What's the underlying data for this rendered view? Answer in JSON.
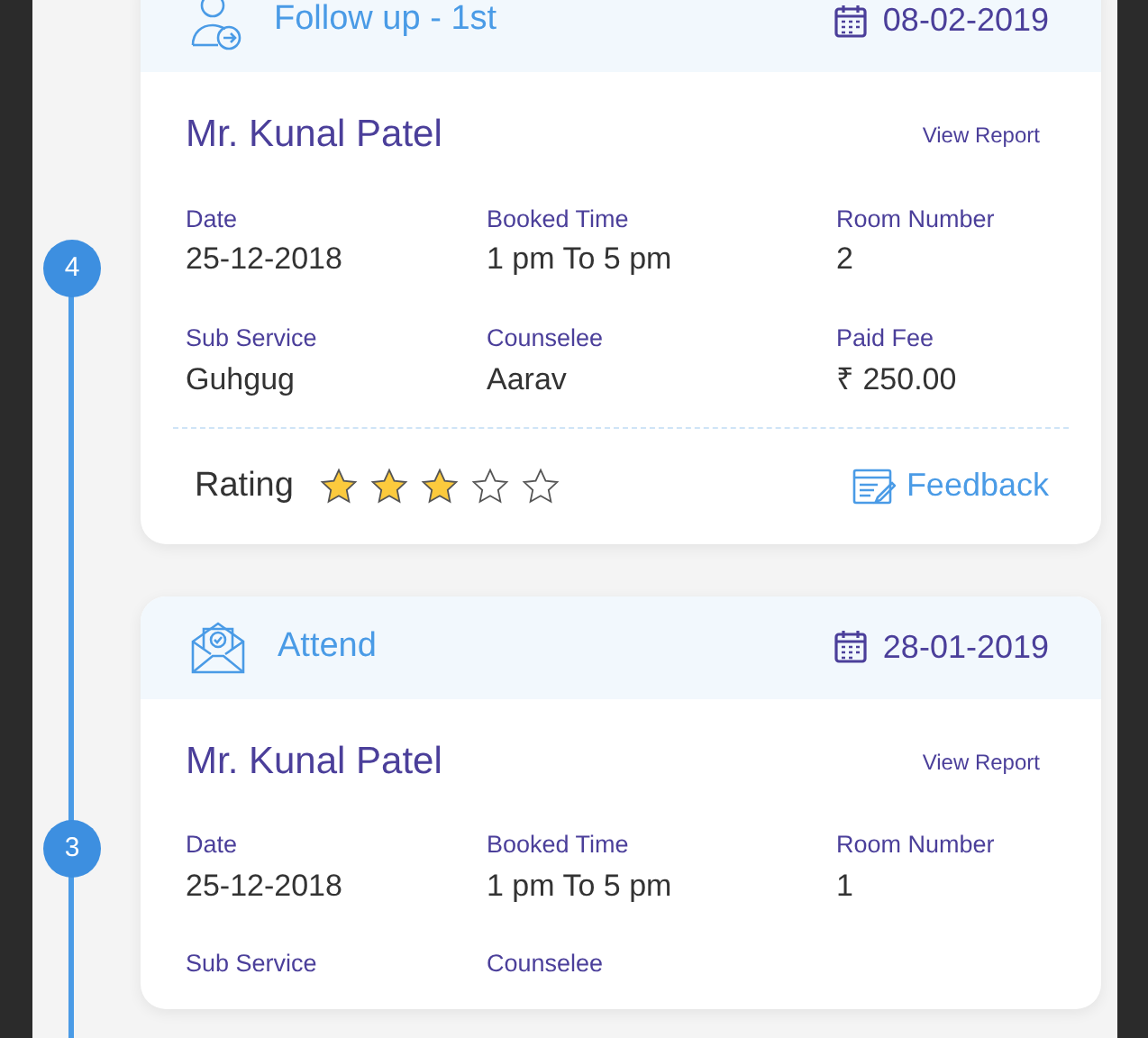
{
  "timeline": [
    {
      "step": "4",
      "header": {
        "title": "Follow up - 1st",
        "date": "08-02-2019"
      },
      "name": "Mr. Kunal Patel",
      "view_report": "View Report",
      "fields": [
        {
          "label": "Date",
          "value": "25-12-2018"
        },
        {
          "label": "Booked Time",
          "value": "1 pm To 5 pm"
        },
        {
          "label": "Room Number",
          "value": "2"
        },
        {
          "label": "Sub Service",
          "value": "Guhgug"
        },
        {
          "label": "Counselee",
          "value": "Aarav"
        },
        {
          "label": "Paid Fee",
          "value": "₹ 250.00"
        }
      ],
      "rating": {
        "label": "Rating",
        "stars": 3
      },
      "feedback": "Feedback"
    },
    {
      "step": "3",
      "header": {
        "title": "Attend",
        "date": "28-01-2019"
      },
      "name": "Mr. Kunal Patel",
      "view_report": "View Report",
      "fields": [
        {
          "label": "Date",
          "value": "25-12-2018"
        },
        {
          "label": "Booked Time",
          "value": "1 pm To 5 pm"
        },
        {
          "label": "Room Number",
          "value": "1"
        },
        {
          "label": "Sub Service"
        },
        {
          "label": "Counselee"
        }
      ]
    }
  ]
}
